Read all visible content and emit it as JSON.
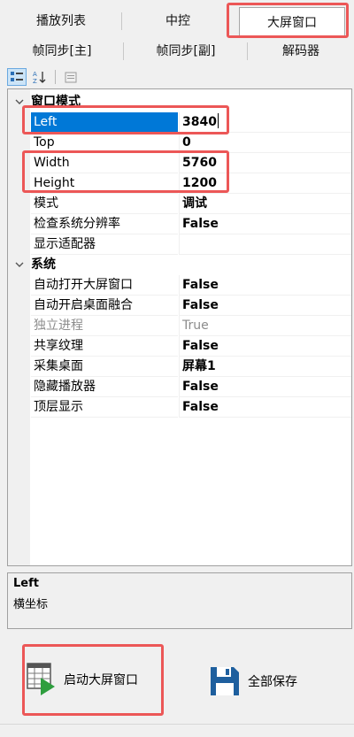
{
  "tabs_row1": [
    {
      "label": "播放列表",
      "active": false
    },
    {
      "label": "中控",
      "active": false
    },
    {
      "label": "大屏窗口",
      "active": true
    }
  ],
  "tabs_row2": [
    {
      "label": "帧同步[主]"
    },
    {
      "label": "帧同步[副]"
    },
    {
      "label": "解码器"
    }
  ],
  "grid": {
    "cat_window": "窗口模式",
    "rows_window": [
      {
        "name": "Left",
        "value": "3840"
      },
      {
        "name": "Top",
        "value": "0"
      },
      {
        "name": "Width",
        "value": "5760"
      },
      {
        "name": "Height",
        "value": "1200"
      },
      {
        "name": "模式",
        "value": "调试"
      },
      {
        "name": "检查系统分辨率",
        "value": "False"
      },
      {
        "name": "显示适配器",
        "value": ""
      }
    ],
    "cat_system": "系统",
    "rows_system": [
      {
        "name": "自动打开大屏窗口",
        "value": "False"
      },
      {
        "name": "自动开启桌面融合",
        "value": "False"
      },
      {
        "name": "独立进程",
        "value": "True"
      },
      {
        "name": "共享纹理",
        "value": "False"
      },
      {
        "name": "采集桌面",
        "value": "屏幕1"
      },
      {
        "name": "隐藏播放器",
        "value": "False"
      },
      {
        "name": "顶层显示",
        "value": "False"
      }
    ]
  },
  "description": {
    "title": "Left",
    "text": "横坐标"
  },
  "buttons": {
    "launch": "启动大屏窗口",
    "save_all": "全部保存"
  },
  "colors": {
    "highlight": "#ec5757",
    "selection": "#0078d7",
    "save_icon": "#1e5f9e",
    "play_icon": "#2e9e3e"
  }
}
